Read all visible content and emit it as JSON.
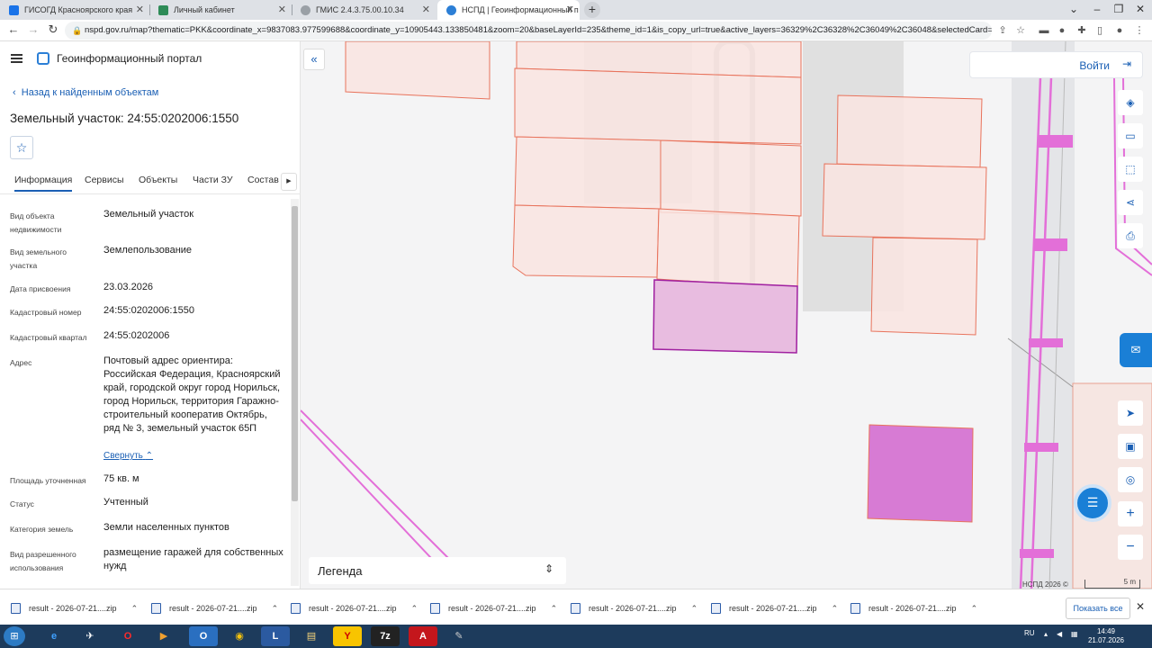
{
  "browser": {
    "tabs": [
      {
        "title": "ГИСОГД Красноярского края",
        "icon_name": "map-icon",
        "icon_color": "#1a73e8",
        "active": false
      },
      {
        "title": "Личный кабинет",
        "icon_name": "cabinet-icon",
        "icon_color": "#2e8b57",
        "active": false
      },
      {
        "title": "ГМИС 2.4.3.75.00.10.34",
        "icon_name": "globe-icon",
        "icon_color": "#6b6b6b",
        "active": false
      },
      {
        "title": "НСПД | Геоинформационный п",
        "icon_name": "nspd-icon",
        "icon_color": "#2c7fd6",
        "active": true
      }
    ],
    "new_tab": "+",
    "url": "nspd.gov.ru/map?thematic=PKK&coordinate_x=9837083.977599688&coordinate_y=10905443.133850481&zoom=20&baseLayerId=235&theme_id=1&is_copy_url=true&active_layers=36329%2C36328%2C36049%2C36048&selectedCard=171..."
  },
  "app": {
    "title": "Геоинформационный портал",
    "back_link": "Назад к найденным объектам",
    "object_title": "Земельный участок: 24:55:0202006:1550",
    "tabs": [
      "Информация",
      "Сервисы",
      "Объекты",
      "Части ЗУ",
      "Состав"
    ],
    "properties": [
      {
        "label": "Вид объекта недвижимости",
        "value": "Земельный участок"
      },
      {
        "label": "Вид земельного участка",
        "value": "Землепользование"
      },
      {
        "label": "Дата присвоения",
        "value": "23.03.2026"
      },
      {
        "label": "Кадастровый номер",
        "value": "24:55:0202006:1550"
      },
      {
        "label": "Кадастровый квартал",
        "value": "24:55:0202006"
      },
      {
        "label": "Адрес",
        "value": "Почтовый адрес ориентира: Российская Федерация, Красноярский край, городской округ город Норильск, город Норильск, территория Гаражно-строительный кооператив Октябрь, ряд № 3, земельный участок 65П"
      },
      {
        "label": "Площадь уточненная",
        "value": "75 кв. м"
      },
      {
        "label": "Статус",
        "value": "Учтенный"
      },
      {
        "label": "Категория земель",
        "value": "Земли населенных пунктов"
      },
      {
        "label": "Вид разрешенного использования",
        "value": "размещение гаражей для собственных нужд"
      }
    ],
    "collapse_link": "Свернуть"
  },
  "map": {
    "login_label": "Войти",
    "legend_label": "Легенда",
    "credits": "НСПД 2026 ©",
    "scale_label": "5 m",
    "parcel_fill": "#f9e4e0",
    "parcel_stroke": "#e8735c",
    "selected_fill": "#e8bce0",
    "selected_stroke": "#a020a0",
    "highlight_fill": "#d77bd4",
    "line_color": "#e36fd8"
  },
  "downloads": {
    "items": [
      "result - 2026-07-21....zip",
      "result - 2026-07-21....zip",
      "result - 2026-07-21....zip",
      "result - 2026-07-21....zip",
      "result - 2026-07-21....zip",
      "result - 2026-07-21....zip",
      "result - 2026-07-21....zip"
    ],
    "show_all": "Показать все"
  },
  "taskbar": {
    "language": "RU",
    "time": "14:49",
    "date": "21.07.2026"
  }
}
